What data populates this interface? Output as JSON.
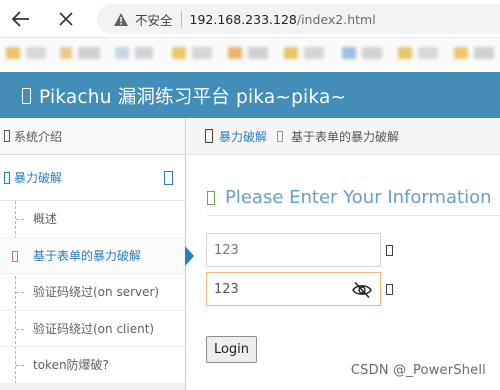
{
  "browser": {
    "security_label": "不安全",
    "url_host": "192.168.233.128",
    "url_path": "/index2.html"
  },
  "header": {
    "title": "Pikachu 漏洞练习平台 pika~pika~",
    "background": "#438eb9"
  },
  "sidebar": {
    "system_intro": "系统介绍",
    "group_label": "暴力破解",
    "items": [
      {
        "label": "概述"
      },
      {
        "label": "基于表单的暴力破解",
        "active": true
      },
      {
        "label": "验证码绕过(on server)"
      },
      {
        "label": "验证码绕过(on client)"
      },
      {
        "label": "token防爆破?"
      }
    ]
  },
  "breadcrumb": {
    "link": "暴力破解",
    "current": "基于表单的暴力破解"
  },
  "form": {
    "title": "Please Enter Your Information",
    "username_value": "123",
    "password_value": "123",
    "login_label": "Login"
  },
  "watermark": "CSDN @_PowerShell",
  "colors": {
    "accent": "#2b7dbc",
    "title": "#669fc7",
    "focus_border": "#f0b97c"
  }
}
